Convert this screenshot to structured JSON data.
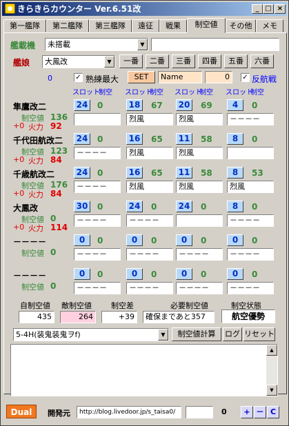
{
  "app": {
    "title": "きらきらカウンター Ver.6.51改"
  },
  "tabs": [
    "第一艦隊",
    "第二艦隊",
    "第三艦隊",
    "遠征",
    "戦果",
    "制空値",
    "その他",
    "メモ"
  ],
  "header": {
    "kansai_label": "艦載機",
    "kansai_value": "未搭載",
    "kanmusu_label": "艦娘",
    "kanmusu_value": "大鳳改",
    "order_buttons": [
      "一番",
      "二番",
      "三番",
      "四番",
      "五番",
      "六番"
    ],
    "counter": "0",
    "jukuren_label": "熟練最大",
    "set_label": "SET",
    "name_value": "Name",
    "name_count": "0",
    "hankou_label": "反航戦"
  },
  "col_labels": {
    "slot": "スロット",
    "seiku": "制空"
  },
  "stat_labels": {
    "seiku": "制空値",
    "karyoku": "火力",
    "plus": "+0"
  },
  "ships": [
    {
      "name": "隼鷹改二",
      "seiku": "136",
      "karyoku": "92",
      "slots": [
        {
          "n": "24",
          "v": "0",
          "plane": ""
        },
        {
          "n": "18",
          "v": "67",
          "plane": "烈風"
        },
        {
          "n": "20",
          "v": "69",
          "plane": "烈風"
        },
        {
          "n": "4",
          "v": "0",
          "plane": "－－－－"
        }
      ]
    },
    {
      "name": "千代田航改二",
      "seiku": "123",
      "karyoku": "84",
      "slots": [
        {
          "n": "24",
          "v": "0",
          "plane": "－－－－"
        },
        {
          "n": "16",
          "v": "65",
          "plane": "烈風"
        },
        {
          "n": "11",
          "v": "58",
          "plane": "烈風"
        },
        {
          "n": "8",
          "v": "0",
          "plane": ""
        }
      ]
    },
    {
      "name": "千歳航改二",
      "seiku": "176",
      "karyoku": "84",
      "slots": [
        {
          "n": "24",
          "v": "0",
          "plane": "－－－－"
        },
        {
          "n": "16",
          "v": "65",
          "plane": "烈風"
        },
        {
          "n": "11",
          "v": "58",
          "plane": "烈風"
        },
        {
          "n": "8",
          "v": "53",
          "plane": "烈風"
        }
      ]
    },
    {
      "name": "大鳳改",
      "seiku": "0",
      "karyoku": "114",
      "slots": [
        {
          "n": "30",
          "v": "0",
          "plane": "－－－－"
        },
        {
          "n": "24",
          "v": "0",
          "plane": "－－－－"
        },
        {
          "n": "24",
          "v": "0",
          "plane": ""
        },
        {
          "n": "8",
          "v": "0",
          "plane": "－－－－"
        }
      ]
    },
    {
      "name": "－－－－",
      "seiku": "0",
      "karyoku": "",
      "slots": [
        {
          "n": "0",
          "v": "0",
          "plane": "－－－－"
        },
        {
          "n": "0",
          "v": "0",
          "plane": "－－－－"
        },
        {
          "n": "0",
          "v": "0",
          "plane": "－－－－"
        },
        {
          "n": "0",
          "v": "0",
          "plane": "－－－－"
        }
      ]
    },
    {
      "name": "－－－－",
      "seiku": "0",
      "karyoku": "",
      "slots": [
        {
          "n": "0",
          "v": "0",
          "plane": "－－－－"
        },
        {
          "n": "0",
          "v": "0",
          "plane": "－－－－"
        },
        {
          "n": "0",
          "v": "0",
          "plane": "－－－－"
        },
        {
          "n": "0",
          "v": "0",
          "plane": "－－－－"
        }
      ]
    }
  ],
  "summary": {
    "labels": [
      "自制空値",
      "敵制空値",
      "制空差",
      "必要制空値",
      "制空状態"
    ],
    "self": "435",
    "enemy": "264",
    "diff": "+39",
    "need": "確保まであと357",
    "state": "航空優勢"
  },
  "map": {
    "value": "5-4H(装鬼装鬼ヲf)",
    "calc_label": "制空値計算",
    "log_label": "ログ",
    "reset_label": "リセット"
  },
  "footer": {
    "dual": "Dual",
    "dev_label": "開発元",
    "url": "http://blog.livedoor.jp/s_taisa0/",
    "count": "0",
    "plus": "+",
    "minus": "－",
    "c": "C"
  }
}
